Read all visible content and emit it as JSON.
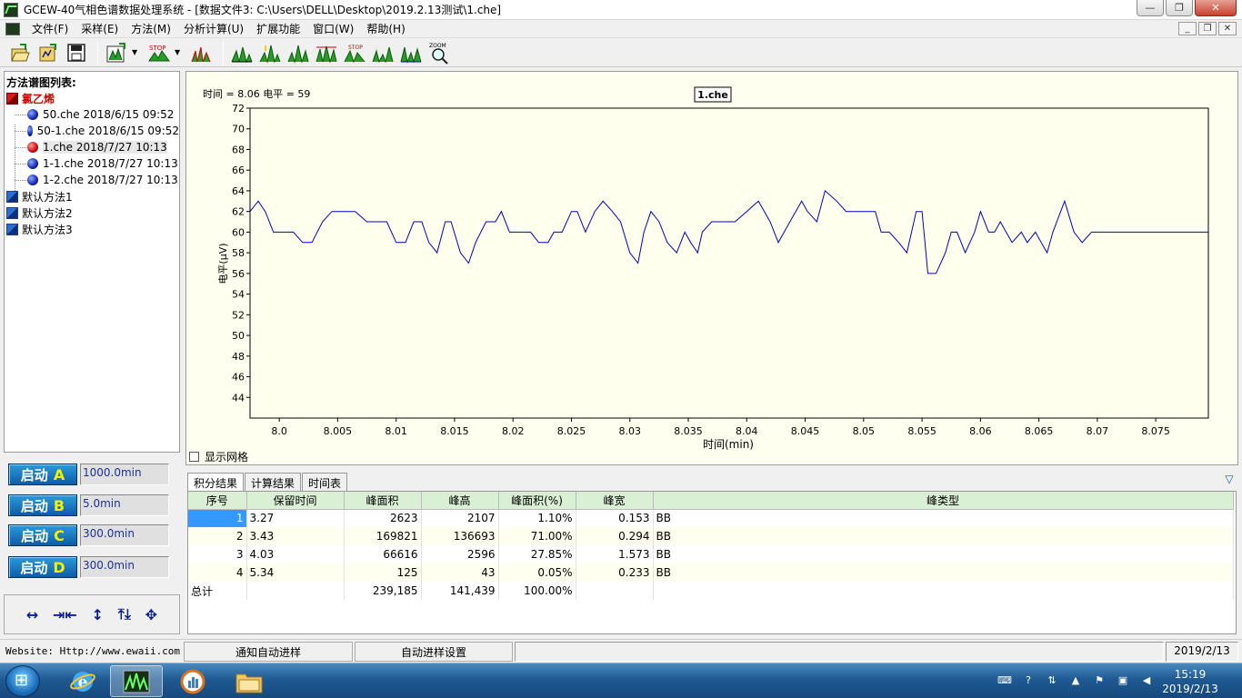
{
  "window": {
    "title": "GCEW-40气相色谱数据处理系统 - [数据文件3: C:\\Users\\DELL\\Desktop\\2019.2.13测试\\1.che]",
    "controls": {
      "minimize": "—",
      "restore": "❐",
      "close": "✕"
    }
  },
  "menu": {
    "items": [
      "文件(F)",
      "采样(E)",
      "方法(M)",
      "分析计算(U)",
      "扩展功能",
      "窗口(W)",
      "帮助(H)"
    ],
    "mdi_controls": {
      "minimize": "_",
      "restore": "❐",
      "close": "✕"
    }
  },
  "toolbar": {
    "icons": [
      "open-icon",
      "save-method-icon",
      "save-data-icon",
      "import-chart-icon",
      "stop-chart-icon",
      "peak-chart-icon",
      "integrate-1-icon",
      "integrate-2-icon",
      "integrate-3-icon",
      "integrate-4-icon",
      "stop-integrate-icon",
      "peaks-icon",
      "peaks-2-icon",
      "zoom-icon"
    ],
    "stop_label": "STOP",
    "zoom_label": "ZOOM"
  },
  "left_panel": {
    "title": "方法谱图列表:",
    "tree": {
      "root": "氯乙烯",
      "files": [
        {
          "name": "50.che 2018/6/15 09:52",
          "color": "blue"
        },
        {
          "name": "50-1.che 2018/6/15 09:52",
          "color": "blue"
        },
        {
          "name": "1.che 2018/7/27 10:13",
          "color": "red"
        },
        {
          "name": "1-1.che 2018/7/27 10:13",
          "color": "blue"
        },
        {
          "name": "1-2.che 2018/7/27 10:13",
          "color": "blue"
        }
      ],
      "methods": [
        "默认方法1",
        "默认方法2",
        "默认方法3"
      ]
    }
  },
  "start_buttons": [
    {
      "label": "启动",
      "letter": "A",
      "value": "1000.0min"
    },
    {
      "label": "启动",
      "letter": "B",
      "value": "5.0min"
    },
    {
      "label": "启动",
      "letter": "C",
      "value": "300.0min"
    },
    {
      "label": "启动",
      "letter": "D",
      "value": "300.0min"
    }
  ],
  "arrows": [
    "↔",
    "⇥⇤",
    "↕",
    "⤒⤓",
    "✥"
  ],
  "chart": {
    "cursor_readout": "时间 = 8.06 电平 = 59",
    "file_label": "1.che",
    "grid_toggle_label": "显示网格",
    "grid_on": false,
    "line_color": "#0000cc",
    "background": "#ffffee"
  },
  "chart_data": {
    "type": "line",
    "title": "",
    "xlabel": "时间(min)",
    "ylabel": "电平(μV)",
    "xlim": [
      7.9975,
      8.0795
    ],
    "ylim": [
      42,
      72
    ],
    "xticks": [
      8.0,
      8.005,
      8.01,
      8.015,
      8.02,
      8.025,
      8.03,
      8.035,
      8.04,
      8.045,
      8.05,
      8.055,
      8.06,
      8.065,
      8.07,
      8.075
    ],
    "xtick_labels": [
      "8.0",
      "8.005",
      "8.01",
      "8.015",
      "8.02",
      "8.025",
      "8.03",
      "8.035",
      "8.04",
      "8.045",
      "8.05",
      "8.055",
      "8.06",
      "8.065",
      "8.07",
      "8.075"
    ],
    "yticks": [
      44,
      46,
      48,
      50,
      52,
      54,
      56,
      58,
      60,
      62,
      64,
      66,
      68,
      70,
      72
    ],
    "series": [
      {
        "x": [
          7.9975,
          7.9982,
          7.9988,
          7.9995,
          8.0003,
          8.0012,
          8.002,
          8.0028,
          8.0037,
          8.0045,
          8.0055,
          8.0065,
          8.0075,
          8.0085,
          8.0092,
          8.01,
          8.0108,
          8.0115,
          8.0122,
          8.0128,
          8.0135,
          8.0142,
          8.0147,
          8.0155,
          8.0162,
          8.0168,
          8.0177,
          8.0185,
          8.019,
          8.0197,
          8.0205,
          8.0215,
          8.0222,
          8.023,
          8.0235,
          8.0242,
          8.025,
          8.0255,
          8.0262,
          8.027,
          8.0277,
          8.0285,
          8.0292,
          8.03,
          8.0307,
          8.0312,
          8.0318,
          8.0325,
          8.0332,
          8.034,
          8.0347,
          8.0352,
          8.0358,
          8.0362,
          8.037,
          8.0377,
          8.0385,
          8.039,
          8.04,
          8.041,
          8.042,
          8.0427,
          8.0437,
          8.0447,
          8.0452,
          8.046,
          8.0467,
          8.0477,
          8.0485,
          8.0495,
          8.0505,
          8.051,
          8.0515,
          8.0522,
          8.053,
          8.0537,
          8.0545,
          8.055,
          8.0555,
          8.0562,
          8.057,
          8.0575,
          8.058,
          8.0587,
          8.0595,
          8.06,
          8.0607,
          8.0612,
          8.0617,
          8.0622,
          8.0627,
          8.0635,
          8.064,
          8.0647,
          8.0657,
          8.0662,
          8.0672,
          8.068,
          8.0687,
          8.0695,
          8.0702,
          8.0708,
          8.0715,
          8.0725,
          8.073,
          8.074,
          8.0748,
          8.0755,
          8.076,
          8.0767,
          8.0773,
          8.0778,
          8.0782,
          8.0788,
          8.0795
        ],
        "y": [
          62,
          63,
          62,
          60,
          60,
          60,
          59,
          59,
          61,
          62,
          62,
          62,
          61,
          61,
          61,
          59,
          59,
          61,
          61,
          59,
          58,
          61,
          61,
          58,
          57,
          59,
          61,
          61,
          62,
          60,
          60,
          60,
          59,
          59,
          60,
          60,
          62,
          62,
          60,
          62,
          63,
          62,
          61,
          58,
          57,
          60,
          62,
          61,
          59,
          58,
          60,
          59,
          58,
          60,
          61,
          61,
          61,
          61,
          62,
          63,
          61,
          59,
          61,
          63,
          62,
          61,
          64,
          63,
          62,
          62,
          62,
          62,
          60,
          60,
          59,
          58,
          62,
          62,
          56,
          56,
          58,
          60,
          60,
          58,
          60,
          62,
          60,
          60,
          61,
          60,
          59,
          60,
          59,
          60,
          58,
          60,
          63,
          60,
          59,
          60,
          60,
          60,
          60,
          60,
          60,
          60,
          60,
          60,
          60,
          60,
          60,
          60,
          60,
          60,
          60
        ]
      }
    ]
  },
  "results": {
    "tabs": [
      "积分结果",
      "计算结果",
      "时间表"
    ],
    "columns": [
      "序号",
      "保留时间",
      "峰面积",
      "峰高",
      "峰面积(%)",
      "峰宽",
      "峰类型"
    ],
    "rows": [
      [
        "1",
        "3.27",
        "2623",
        "2107",
        "1.10%",
        "0.153",
        "BB"
      ],
      [
        "2",
        "3.43",
        "169821",
        "136693",
        "71.00%",
        "0.294",
        "BB"
      ],
      [
        "3",
        "4.03",
        "66616",
        "2596",
        "27.85%",
        "1.573",
        "BB"
      ],
      [
        "4",
        "5.34",
        "125",
        "43",
        "0.05%",
        "0.233",
        "BB"
      ]
    ],
    "total_row": [
      "总计",
      "",
      "239,185",
      "141,439",
      "100.00%",
      "",
      ""
    ]
  },
  "statusbar": {
    "website": "Website: Http://www.ewaii.com",
    "notify_button": "通知自动进样",
    "autosampler_button": "自动进样设置",
    "date": "2019/2/13"
  },
  "taskbar": {
    "time": "15:19",
    "date": "2019/2/13"
  }
}
